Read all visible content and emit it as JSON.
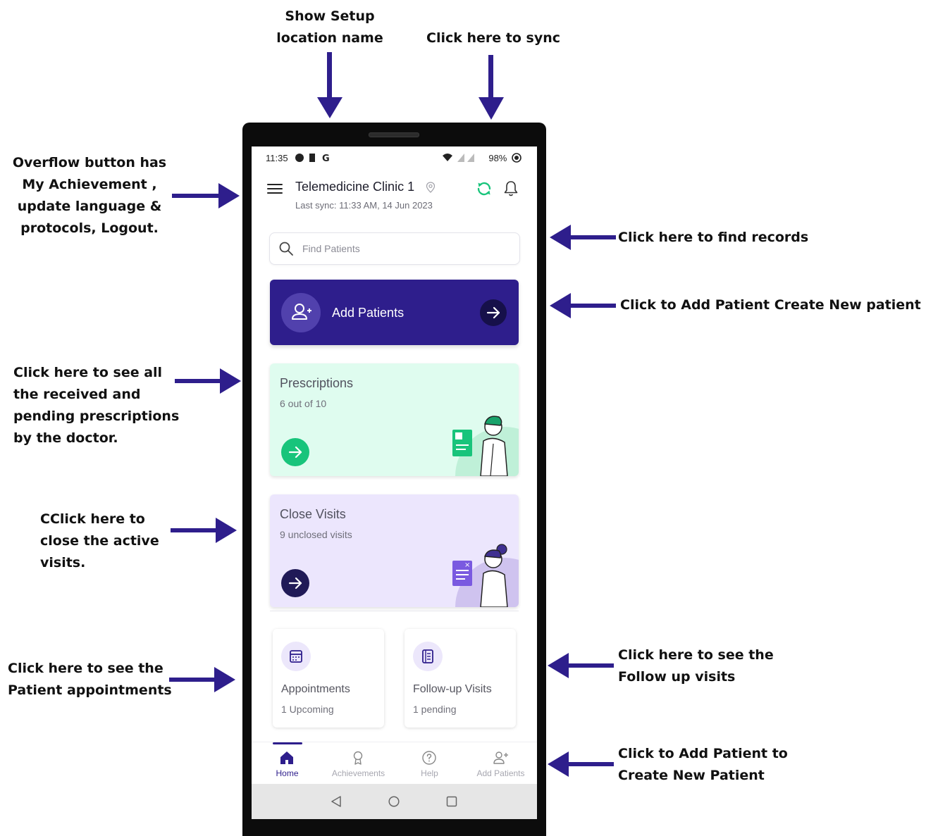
{
  "annotations": {
    "setup_location": [
      "Show Setup",
      "location name"
    ],
    "sync": [
      "Click here to sync"
    ],
    "overflow": [
      "Overflow button has",
      "My Achievement ,",
      "update language &",
      "protocols, Logout."
    ],
    "find_records": [
      "Click here to find records"
    ],
    "add_patient": [
      "Click to Add Patient Create New patient"
    ],
    "prescriptions": [
      "Click here to see all",
      "the received and",
      "pending prescriptions",
      "by the doctor."
    ],
    "close_visits": [
      "CClick here to",
      "close the active",
      "visits."
    ],
    "appointments": [
      "Click here to see the",
      "Patient appointments"
    ],
    "followup": [
      "Click here to see the",
      "Follow up visits"
    ],
    "add_patient_tab": [
      "Click to Add Patient to",
      "Create New Patient"
    ]
  },
  "status_bar": {
    "time": "11:35",
    "battery": "98%"
  },
  "header": {
    "clinic_name": "Telemedicine Clinic 1",
    "last_sync": "Last sync: 11:33 AM, 14 Jun 2023"
  },
  "search": {
    "placeholder": "Find Patients"
  },
  "add_patients_card": {
    "label": "Add Patients"
  },
  "prescriptions_card": {
    "title": "Prescriptions",
    "subtitle": "6 out of 10"
  },
  "close_visits_card": {
    "title": "Close Visits",
    "subtitle": "9 unclosed visits"
  },
  "appointments_tile": {
    "title": "Appointments",
    "subtitle": "1 Upcoming"
  },
  "followup_tile": {
    "title": "Follow-up Visits",
    "subtitle": "1 pending"
  },
  "tabs": [
    {
      "label": "Home",
      "icon": "home-icon"
    },
    {
      "label": "Achievements",
      "icon": "award-icon"
    },
    {
      "label": "Help",
      "icon": "help-icon"
    },
    {
      "label": "Add Patients",
      "icon": "add-user-icon"
    }
  ],
  "colors": {
    "accent": "#2e1e8c",
    "arrow": "#2e1e8c",
    "sync": "#18c47b",
    "prescriptions_bg": "#dffcef",
    "close_visits_bg": "#ece6fd"
  }
}
